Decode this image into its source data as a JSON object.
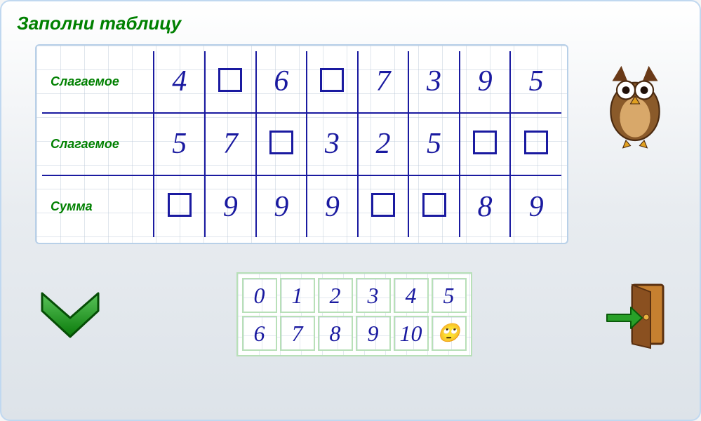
{
  "title": "Заполни таблицу",
  "rows": [
    {
      "label": "Слагаемое",
      "cells": [
        "4",
        "",
        "6",
        "",
        "7",
        "3",
        "9",
        "5"
      ]
    },
    {
      "label": "Слагаемое",
      "cells": [
        "5",
        "7",
        "",
        "3",
        "2",
        "5",
        "",
        ""
      ]
    },
    {
      "label": "Сумма",
      "cells": [
        "",
        "9",
        "9",
        "9",
        "",
        "",
        "8",
        "9"
      ]
    }
  ],
  "picker": {
    "row1": [
      "0",
      "1",
      "2",
      "3",
      "4",
      "5"
    ],
    "row2": [
      "6",
      "7",
      "8",
      "9",
      "10"
    ],
    "hint_icon": "🙄"
  },
  "icons": {
    "owl": "owl-icon",
    "confirm": "chevron-down-icon",
    "exit": "door-icon"
  }
}
